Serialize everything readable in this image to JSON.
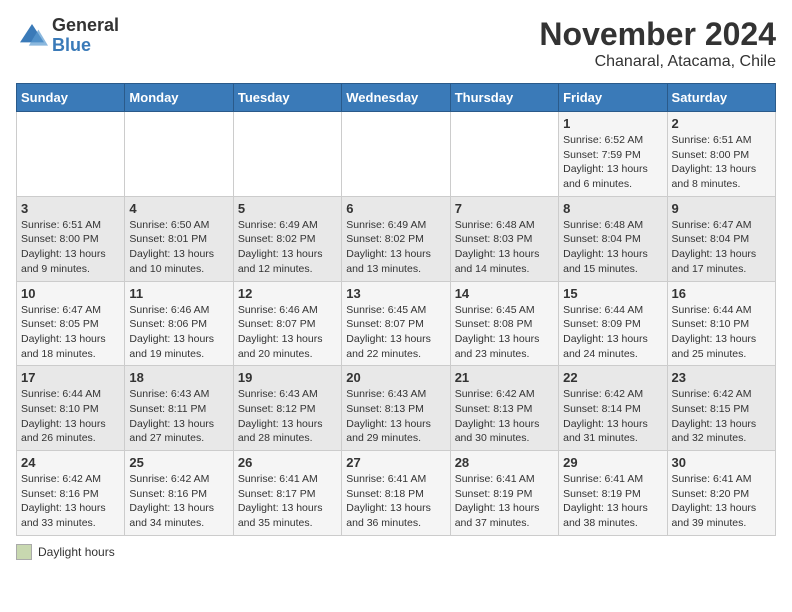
{
  "logo": {
    "general": "General",
    "blue": "Blue"
  },
  "title": "November 2024",
  "subtitle": "Chanaral, Atacama, Chile",
  "days_of_week": [
    "Sunday",
    "Monday",
    "Tuesday",
    "Wednesday",
    "Thursday",
    "Friday",
    "Saturday"
  ],
  "legend_label": "Daylight hours",
  "weeks": [
    [
      {
        "day": "",
        "info": ""
      },
      {
        "day": "",
        "info": ""
      },
      {
        "day": "",
        "info": ""
      },
      {
        "day": "",
        "info": ""
      },
      {
        "day": "",
        "info": ""
      },
      {
        "day": "1",
        "info": "Sunrise: 6:52 AM\nSunset: 7:59 PM\nDaylight: 13 hours and 6 minutes."
      },
      {
        "day": "2",
        "info": "Sunrise: 6:51 AM\nSunset: 8:00 PM\nDaylight: 13 hours and 8 minutes."
      }
    ],
    [
      {
        "day": "3",
        "info": "Sunrise: 6:51 AM\nSunset: 8:00 PM\nDaylight: 13 hours and 9 minutes."
      },
      {
        "day": "4",
        "info": "Sunrise: 6:50 AM\nSunset: 8:01 PM\nDaylight: 13 hours and 10 minutes."
      },
      {
        "day": "5",
        "info": "Sunrise: 6:49 AM\nSunset: 8:02 PM\nDaylight: 13 hours and 12 minutes."
      },
      {
        "day": "6",
        "info": "Sunrise: 6:49 AM\nSunset: 8:02 PM\nDaylight: 13 hours and 13 minutes."
      },
      {
        "day": "7",
        "info": "Sunrise: 6:48 AM\nSunset: 8:03 PM\nDaylight: 13 hours and 14 minutes."
      },
      {
        "day": "8",
        "info": "Sunrise: 6:48 AM\nSunset: 8:04 PM\nDaylight: 13 hours and 15 minutes."
      },
      {
        "day": "9",
        "info": "Sunrise: 6:47 AM\nSunset: 8:04 PM\nDaylight: 13 hours and 17 minutes."
      }
    ],
    [
      {
        "day": "10",
        "info": "Sunrise: 6:47 AM\nSunset: 8:05 PM\nDaylight: 13 hours and 18 minutes."
      },
      {
        "day": "11",
        "info": "Sunrise: 6:46 AM\nSunset: 8:06 PM\nDaylight: 13 hours and 19 minutes."
      },
      {
        "day": "12",
        "info": "Sunrise: 6:46 AM\nSunset: 8:07 PM\nDaylight: 13 hours and 20 minutes."
      },
      {
        "day": "13",
        "info": "Sunrise: 6:45 AM\nSunset: 8:07 PM\nDaylight: 13 hours and 22 minutes."
      },
      {
        "day": "14",
        "info": "Sunrise: 6:45 AM\nSunset: 8:08 PM\nDaylight: 13 hours and 23 minutes."
      },
      {
        "day": "15",
        "info": "Sunrise: 6:44 AM\nSunset: 8:09 PM\nDaylight: 13 hours and 24 minutes."
      },
      {
        "day": "16",
        "info": "Sunrise: 6:44 AM\nSunset: 8:10 PM\nDaylight: 13 hours and 25 minutes."
      }
    ],
    [
      {
        "day": "17",
        "info": "Sunrise: 6:44 AM\nSunset: 8:10 PM\nDaylight: 13 hours and 26 minutes."
      },
      {
        "day": "18",
        "info": "Sunrise: 6:43 AM\nSunset: 8:11 PM\nDaylight: 13 hours and 27 minutes."
      },
      {
        "day": "19",
        "info": "Sunrise: 6:43 AM\nSunset: 8:12 PM\nDaylight: 13 hours and 28 minutes."
      },
      {
        "day": "20",
        "info": "Sunrise: 6:43 AM\nSunset: 8:13 PM\nDaylight: 13 hours and 29 minutes."
      },
      {
        "day": "21",
        "info": "Sunrise: 6:42 AM\nSunset: 8:13 PM\nDaylight: 13 hours and 30 minutes."
      },
      {
        "day": "22",
        "info": "Sunrise: 6:42 AM\nSunset: 8:14 PM\nDaylight: 13 hours and 31 minutes."
      },
      {
        "day": "23",
        "info": "Sunrise: 6:42 AM\nSunset: 8:15 PM\nDaylight: 13 hours and 32 minutes."
      }
    ],
    [
      {
        "day": "24",
        "info": "Sunrise: 6:42 AM\nSunset: 8:16 PM\nDaylight: 13 hours and 33 minutes."
      },
      {
        "day": "25",
        "info": "Sunrise: 6:42 AM\nSunset: 8:16 PM\nDaylight: 13 hours and 34 minutes."
      },
      {
        "day": "26",
        "info": "Sunrise: 6:41 AM\nSunset: 8:17 PM\nDaylight: 13 hours and 35 minutes."
      },
      {
        "day": "27",
        "info": "Sunrise: 6:41 AM\nSunset: 8:18 PM\nDaylight: 13 hours and 36 minutes."
      },
      {
        "day": "28",
        "info": "Sunrise: 6:41 AM\nSunset: 8:19 PM\nDaylight: 13 hours and 37 minutes."
      },
      {
        "day": "29",
        "info": "Sunrise: 6:41 AM\nSunset: 8:19 PM\nDaylight: 13 hours and 38 minutes."
      },
      {
        "day": "30",
        "info": "Sunrise: 6:41 AM\nSunset: 8:20 PM\nDaylight: 13 hours and 39 minutes."
      }
    ]
  ]
}
